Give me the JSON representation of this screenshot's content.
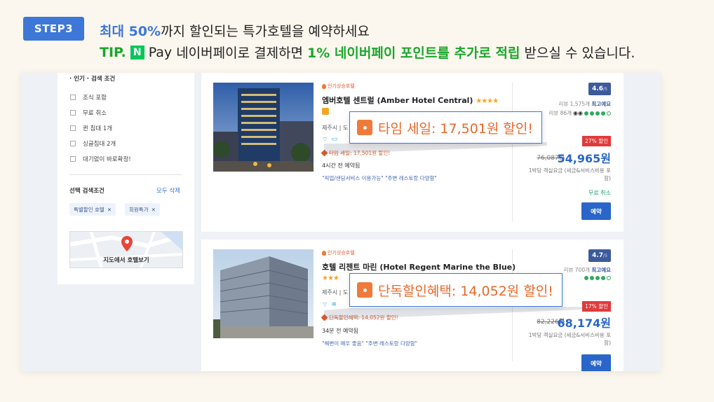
{
  "header": {
    "step_label": "STEP3",
    "headline_highlight": "최대 50%",
    "headline_rest": "까지 할인되는 특가호텔을 예약하세요",
    "tip_label": "TIP.",
    "npay_logo": "N",
    "pay_word": "Pay",
    "tip_text_1": "네이버페이로 결제하면",
    "tip_text_green": "1% 네이버페이 포인트를 추가로 적립",
    "tip_text_2": "받으실 수 있습니다."
  },
  "sidebar": {
    "section_title": "· 인기 · 검색 조건",
    "options": [
      "조식 포함",
      "무료 취소",
      "퀸 침대 1개",
      "싱글침대 2개",
      "대기없이 바로확정!"
    ],
    "selected_title": "선택 검색조건",
    "clear_all": "모두 삭제",
    "chips": [
      "특별할인 호텔",
      "회원특가"
    ],
    "chip_close": "✕",
    "map_label": "지도에서 호텔보기"
  },
  "hotels": [
    {
      "tag": "인기상승호텔",
      "name": "엠버호텔 센트럴 (Amber Hotel Central)",
      "stars": "★★★★",
      "location": "제주시 | 도",
      "sale_text": "타임 세일: 17,501원 할인!",
      "booked": "4시간 전 예약됨",
      "quotes": "\"픽업/샌딩서비스 이용가능\"  \"주변 레스토랑 다양함\"",
      "score": "4.6",
      "score_max": "/5",
      "review_count": "리뷰 1,575개",
      "review_grade": "최고예요",
      "tripadvisor": "리뷰 86개",
      "discount_badge": "27% 할인",
      "original_price": "76,087원",
      "price": "54,965원",
      "price_note": "1박당 객실요금 (세금&서비스비용 포함)",
      "free_cancel": "무료 취소",
      "reserve": "예약"
    },
    {
      "tag": "인기상승호텔",
      "name": "호텔 리젠트 마린 (Hotel Regent Marine the Blue)",
      "stars": "★★★",
      "location": "제주시 | 도",
      "sale_text": "단독할인혜택: 14,052원 할인!",
      "booked": "34분 전 예약됨",
      "quotes": "\"해변이 매우 좋음\"  \"주변 레스토랑 다양함\"",
      "score": "4.7",
      "score_max": "/5",
      "review_count": "리뷰 700개",
      "review_grade": "최고예요",
      "discount_badge": "17% 할인",
      "original_price": "82,226원",
      "price": "68,174원",
      "price_note": "1박당 객실요금 (세금&서비스비용 포함)",
      "reserve": "예약"
    }
  ],
  "callouts": [
    {
      "text": "타임 세일: 17,501원 할인!"
    },
    {
      "text": "단독할인혜택: 14,052원 할인!"
    }
  ],
  "colors": {
    "accent_blue": "#3d77d7",
    "naver_green": "#1aa62b",
    "sale_orange": "#e8682c",
    "price_blue": "#2a66c9",
    "discount_red": "#e03b3b"
  }
}
